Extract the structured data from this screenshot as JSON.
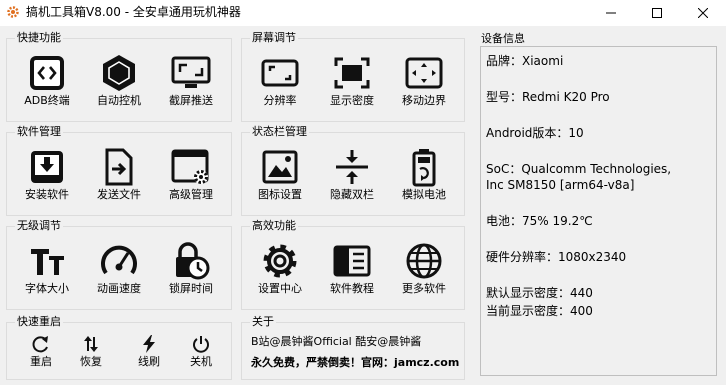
{
  "window": {
    "title": "搞机工具箱V8.00 - 全安卓通用玩机神器",
    "minimize_icon": "minimize-icon",
    "maximize_icon": "maximize-icon",
    "close_icon": "close-icon"
  },
  "groups": {
    "quick": {
      "title": "快捷功能",
      "tools": [
        {
          "label": "ADB终端",
          "icon": "code-terminal-icon"
        },
        {
          "label": "自动控机",
          "icon": "hexagon-icon"
        },
        {
          "label": "截屏推送",
          "icon": "screen-cast-icon"
        }
      ]
    },
    "screen": {
      "title": "屏幕调节",
      "tools": [
        {
          "label": "分辨率",
          "icon": "resolution-icon"
        },
        {
          "label": "显示密度",
          "icon": "fullscreen-icon"
        },
        {
          "label": "移动边界",
          "icon": "move-border-icon"
        }
      ]
    },
    "software": {
      "title": "软件管理",
      "tools": [
        {
          "label": "安装软件",
          "icon": "install-icon"
        },
        {
          "label": "发送文件",
          "icon": "send-file-icon"
        },
        {
          "label": "高级管理",
          "icon": "advanced-settings-icon"
        }
      ]
    },
    "statusbar": {
      "title": "状态栏管理",
      "tools": [
        {
          "label": "图标设置",
          "icon": "image-icon"
        },
        {
          "label": "隐藏双栏",
          "icon": "split-bar-icon"
        },
        {
          "label": "模拟电池",
          "icon": "battery-icon"
        }
      ]
    },
    "stepless": {
      "title": "无级调节",
      "tools": [
        {
          "label": "字体大小",
          "icon": "font-size-icon"
        },
        {
          "label": "动画速度",
          "icon": "speedometer-icon"
        },
        {
          "label": "锁屏时间",
          "icon": "lock-clock-icon"
        }
      ]
    },
    "efficient": {
      "title": "高效功能",
      "tools": [
        {
          "label": "设置中心",
          "icon": "gear-icon"
        },
        {
          "label": "软件教程",
          "icon": "book-icon"
        },
        {
          "label": "更多软件",
          "icon": "globe-icon"
        }
      ]
    },
    "reboot": {
      "title": "快速重启",
      "tools": [
        {
          "label": "重启",
          "icon": "restart-icon"
        },
        {
          "label": "恢复",
          "icon": "recovery-icon"
        },
        {
          "label": "线刷",
          "icon": "flash-icon"
        },
        {
          "label": "关机",
          "icon": "power-icon"
        }
      ]
    },
    "about": {
      "title": "关于",
      "line1": "B站@晨钟酱Official  酷安@晨钟酱",
      "line2": "永久免费，严禁倒卖！官网：jamcz.com"
    }
  },
  "device": {
    "title": "设备信息",
    "lines": [
      "品牌：Xiaomi",
      "型号：Redmi K20 Pro",
      "Android版本：10",
      "SoC：Qualcomm Technologies,",
      "Inc SM8150 [arm64-v8a]",
      "电池：75%  19.2℃",
      "硬件分辨率：1080x2340",
      "默认显示密度：440",
      "当前显示密度：400"
    ]
  }
}
